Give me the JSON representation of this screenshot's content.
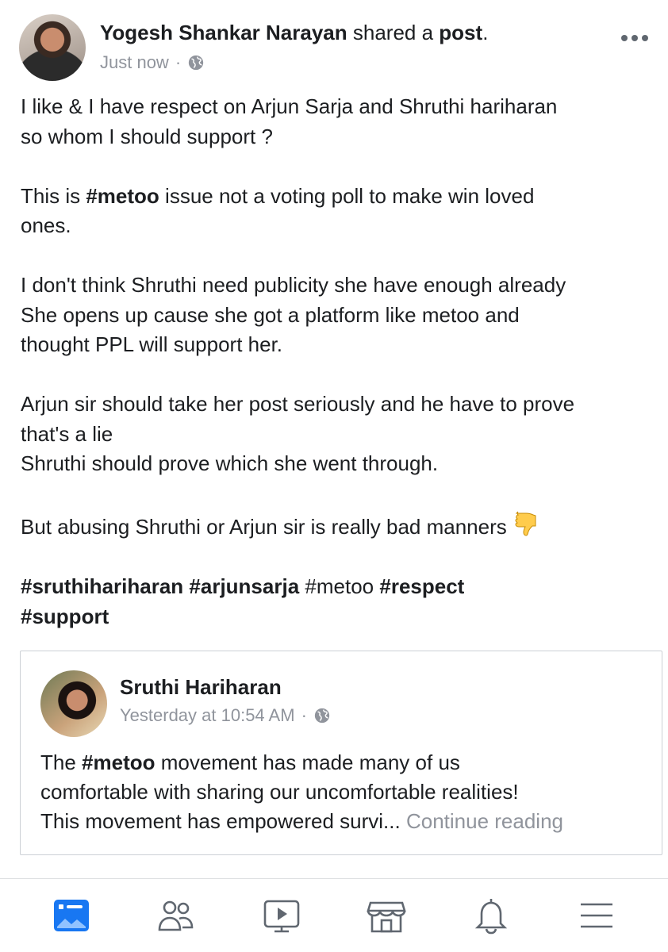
{
  "post": {
    "author": "Yogesh Shankar Narayan",
    "action_text": " shared a ",
    "object": "post",
    "period": ".",
    "time": "Just now",
    "separator": "·",
    "more_icon": "more-dots-icon",
    "body": {
      "p1_line1": "I like & I have respect on Arjun Sarja and Shruthi hariharan",
      "p1_line2": "so whom I should support ?",
      "p2_pre": "This is ",
      "p2_tag": "#metoo",
      "p2_post": " issue not a voting poll to make win loved",
      "p2_line2": "ones.",
      "p3_line1": "I don't think Shruthi need publicity she have enough already",
      "p3_line2": "She opens up cause she got a platform like metoo and",
      "p3_line3": "thought PPL will support her.",
      "p4_line1": "Arjun sir should take her post seriously and he have to prove",
      "p4_line2": "that's a lie",
      "p4_line3": "Shruthi should prove which she went through.",
      "p5": "But abusing Shruthi or Arjun sir is really bad manners",
      "emoji": "thumbs-down-icon",
      "tag1": "#sruthihariharan",
      "tag2": "#arjunsarja",
      "tag3": "#metoo",
      "tag4": "#respect",
      "tag5": "#support"
    }
  },
  "shared": {
    "name": "Sruthi Hariharan",
    "time": "Yesterday at 10:54 AM",
    "separator": "·",
    "text_pre": "The ",
    "text_tag": "#metoo",
    "text_line1_post": " movement has made many of us",
    "text_line2": "comfortable with sharing our uncomfortable realities!",
    "text_line3": "This movement has empowered survi...",
    "continue": "Continue reading"
  },
  "tabbar": {
    "items": [
      "news-feed-icon",
      "friends-icon",
      "watch-icon",
      "marketplace-icon",
      "notifications-icon",
      "menu-icon"
    ],
    "active_color": "#1877f2",
    "inactive_color": "#606770"
  }
}
